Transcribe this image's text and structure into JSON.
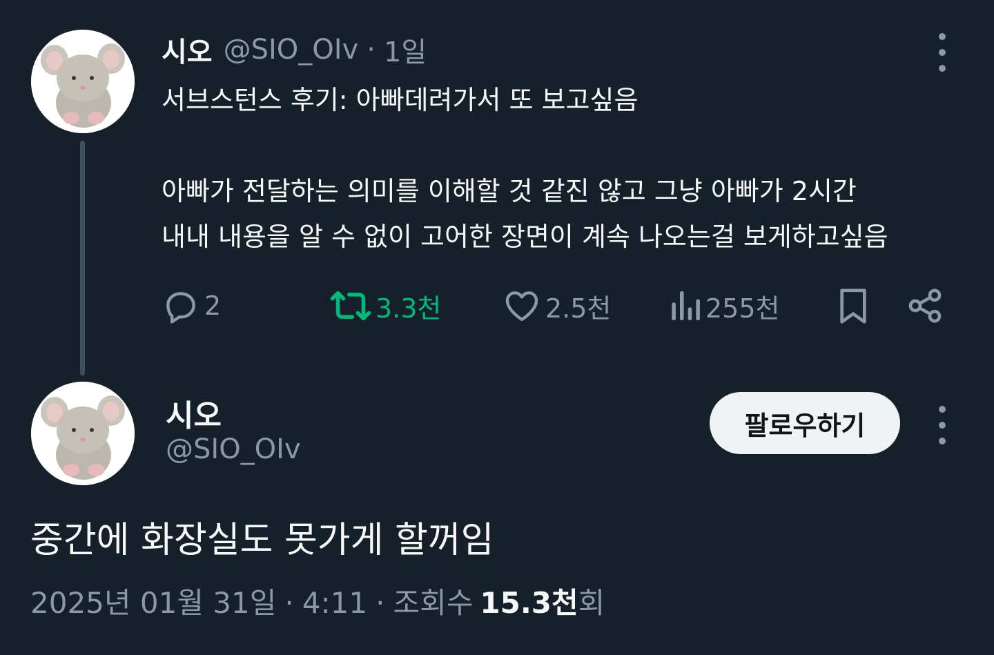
{
  "parent_tweet": {
    "display_name": "시오",
    "handle": "@SIO_OIv",
    "separator": "·",
    "time": "1일",
    "text_line1": "서브스턴스 후기: 아빠데려가서 또 보고싶음",
    "text_line2": "아빠가 전달하는 의미를 이해할 것 같진 않고 그냥 아빠가 2시간",
    "text_line3": "내내 내용을 알 수 없이 고어한 장면이 계속 나오는걸 보게하고싶음",
    "replies": "2",
    "retweets": "3.3천",
    "likes": "2.5천",
    "views": "255천"
  },
  "main_tweet": {
    "display_name": "시오",
    "handle": "@SIO_OIv",
    "follow_label": "팔로우하기",
    "text": "중간에 화장실도 못가게 할꺼임",
    "date": "2025년 01월 31일",
    "separator": "·",
    "time": "4:11",
    "views_label": "조회수",
    "views_count": "15.3천",
    "views_suffix": "회"
  },
  "colors": {
    "background": "#15202b",
    "text_primary": "#f7f9f9",
    "text_secondary": "#8b98a5",
    "retweet_active": "#00ba7c",
    "follow_button_bg": "#eff3f4"
  },
  "icons": {
    "reply": "reply-icon",
    "retweet": "retweet-icon",
    "like": "heart-icon",
    "views": "analytics-icon",
    "bookmark": "bookmark-icon",
    "share": "share-icon",
    "more": "more-icon",
    "avatar": "mouse-plush-avatar"
  }
}
